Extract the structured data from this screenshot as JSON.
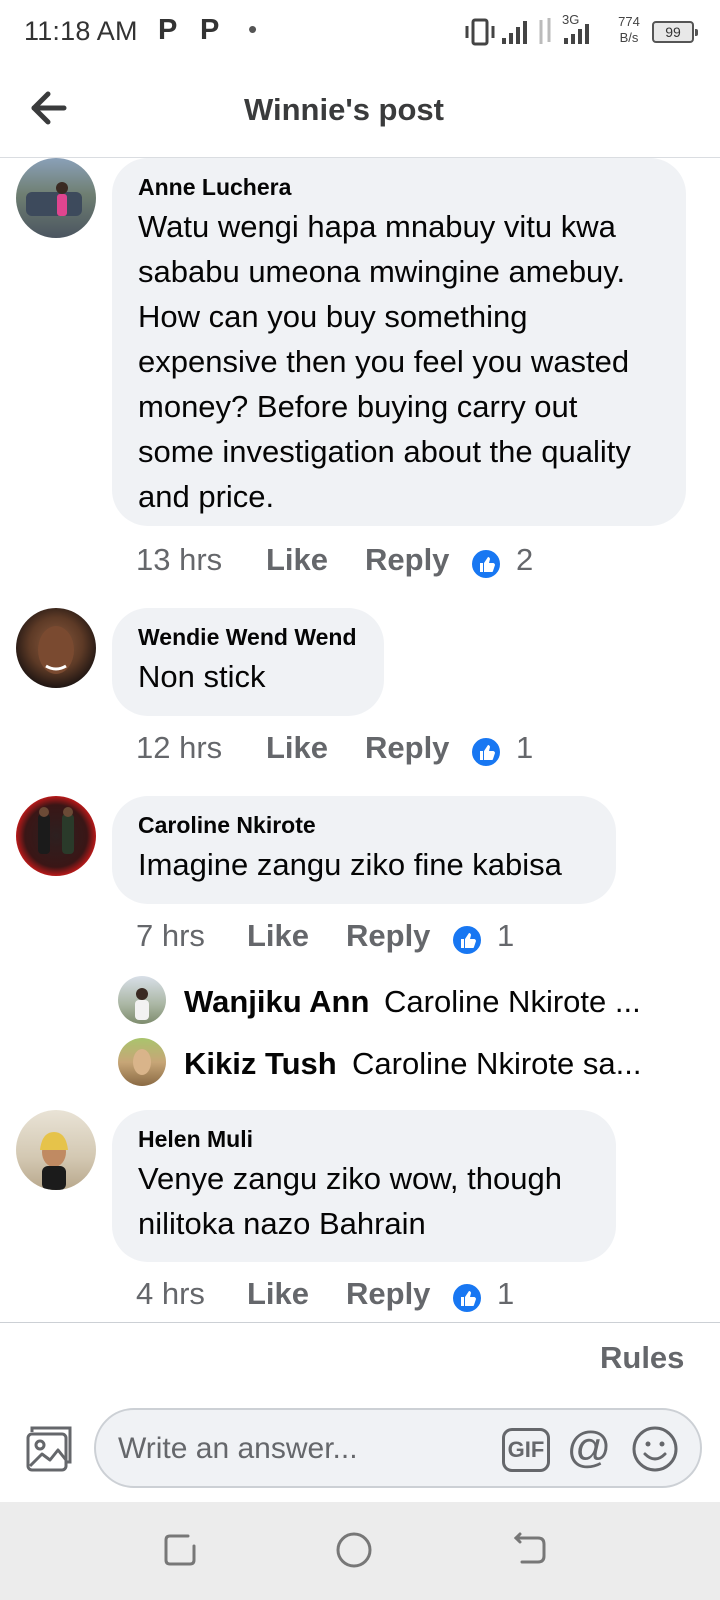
{
  "status_bar": {
    "time": "11:18 AM",
    "icons": [
      "p-notification-icon",
      "p-notification-icon",
      "dot-icon",
      "vibrate-icon",
      "signal-icon",
      "data-icon",
      "signal-3g-icon"
    ],
    "network_label": "3G",
    "net_speed_value": "774",
    "net_speed_unit": "B/s",
    "battery": "99"
  },
  "header": {
    "title": "Winnie's post",
    "back_icon": "arrow-left-icon"
  },
  "colors": {
    "bubble": "#f0f2f5",
    "meta": "#65676b",
    "like_blue": "#1877f2",
    "text": "#050505"
  },
  "comments": [
    {
      "author": "Anne Luchera",
      "text": "Watu wengi hapa mnabuy vitu kwa sababu umeona mwingine amebuy. How can you buy something expensive then you feel you wasted money? Before buying carry out some investigation about the quality and price.",
      "time": "13 hrs",
      "like_label": "Like",
      "reply_label": "Reply",
      "reaction_count": "2"
    },
    {
      "author": "Wendie Wend Wend",
      "text": "Non stick",
      "time": "12 hrs",
      "like_label": "Like",
      "reply_label": "Reply",
      "reaction_count": "1"
    },
    {
      "author": "Caroline Nkirote",
      "text": "Imagine zangu ziko fine kabisa",
      "time": "7 hrs",
      "like_label": "Like",
      "reply_label": "Reply",
      "reaction_count": "1",
      "replies": [
        {
          "author": "Wanjiku Ann",
          "preview": "Caroline Nkirote ..."
        },
        {
          "author": "Kikiz Tush",
          "preview": "Caroline Nkirote sa..."
        }
      ]
    },
    {
      "author": "Helen Muli",
      "text": "Venye zangu ziko wow, though nilitoka nazo Bahrain",
      "time": "4 hrs",
      "like_label": "Like",
      "reply_label": "Reply",
      "reaction_count": "1"
    }
  ],
  "composer": {
    "rules_label": "Rules",
    "placeholder": "Write an answer...",
    "gif_label": "GIF",
    "mention_label": "@",
    "icons": [
      "photo-icon",
      "gif-icon",
      "mention-icon",
      "emoji-icon"
    ]
  },
  "nav_bar": {
    "icons": [
      "recents-icon",
      "home-icon",
      "back-icon"
    ]
  }
}
